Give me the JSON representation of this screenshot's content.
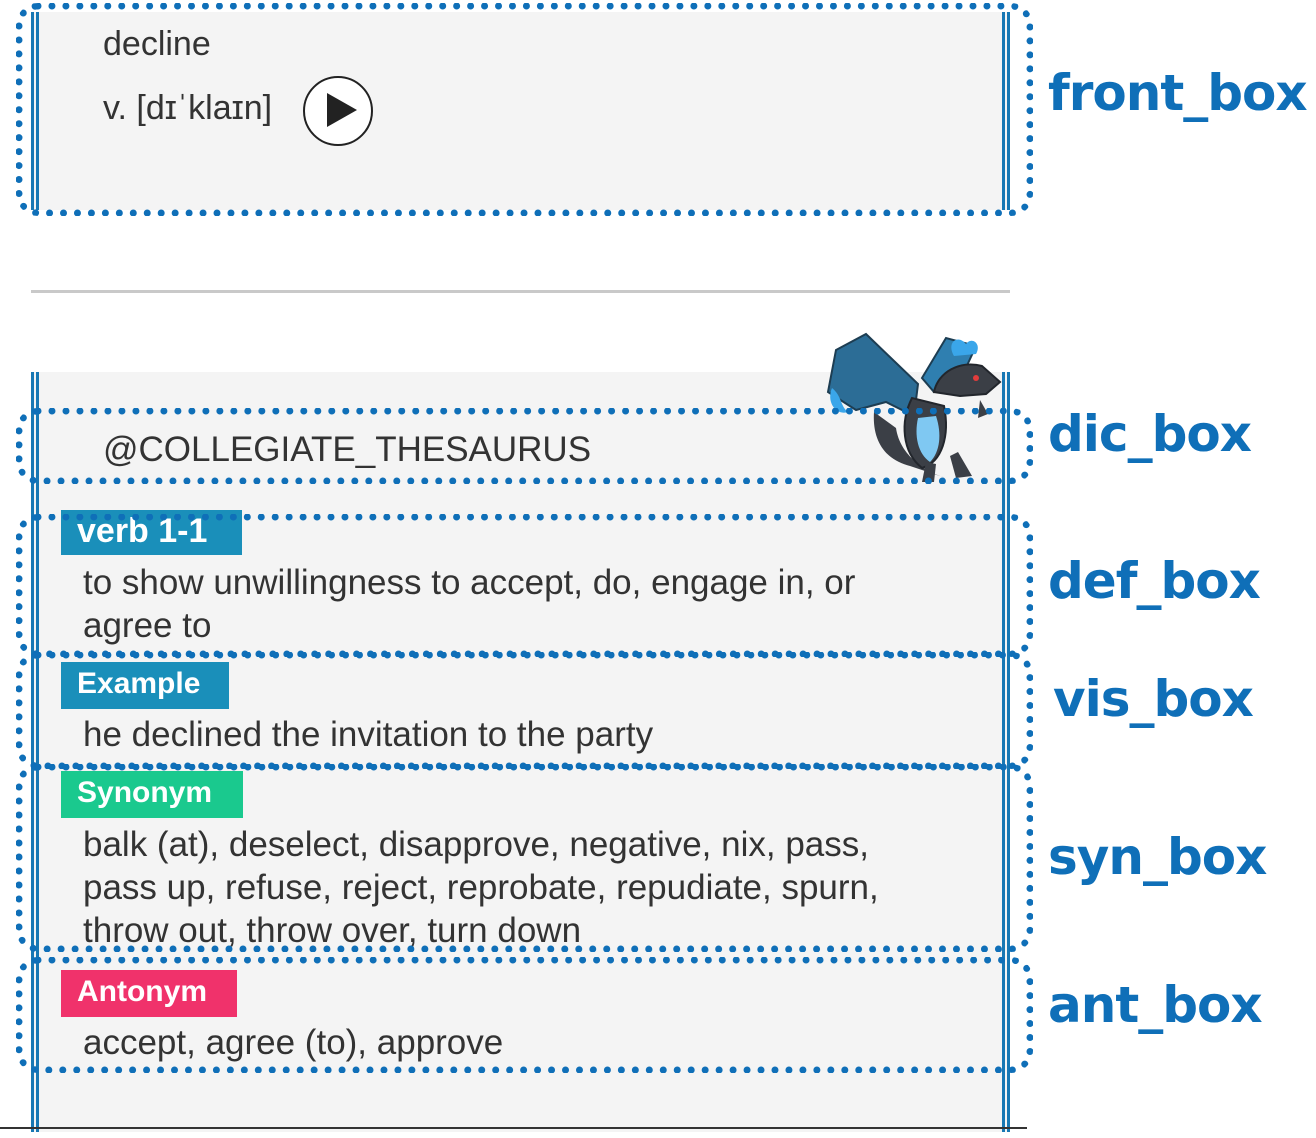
{
  "front": {
    "word": "decline",
    "pronunciation": "v. [dɪˈklaɪn]",
    "play_icon": "play-icon"
  },
  "dictionary": {
    "name": "@COLLEGIATE_THESAURUS",
    "mascot_icon": "dragon-mascot-icon"
  },
  "definition": {
    "tag": "verb 1-1",
    "lines": [
      "to show unwillingness to accept, do, engage in, or",
      "agree to"
    ]
  },
  "example": {
    "tag": "Example",
    "text": "he declined the invitation to the party"
  },
  "synonym": {
    "tag": "Synonym",
    "lines": [
      "balk (at), deselect, disapprove, negative, nix, pass,",
      "pass up, refuse, reject, reprobate, repudiate, spurn,",
      "throw out, throw over, turn down"
    ]
  },
  "antonym": {
    "tag": "Antonym",
    "text": "accept, agree (to), approve"
  },
  "box_labels": {
    "front": "front_box",
    "dic": "dic_box",
    "def": "def_box",
    "vis": "vis_box",
    "syn": "syn_box",
    "ant": "ant_box"
  },
  "colors": {
    "annotation": "#0f6fb8",
    "rail": "#1878b4",
    "tag_definition": "#1a8fba",
    "tag_example": "#1a8fba",
    "tag_synonym": "#1ac98e",
    "tag_antonym": "#f0326b",
    "panel": "#f4f4f4"
  }
}
